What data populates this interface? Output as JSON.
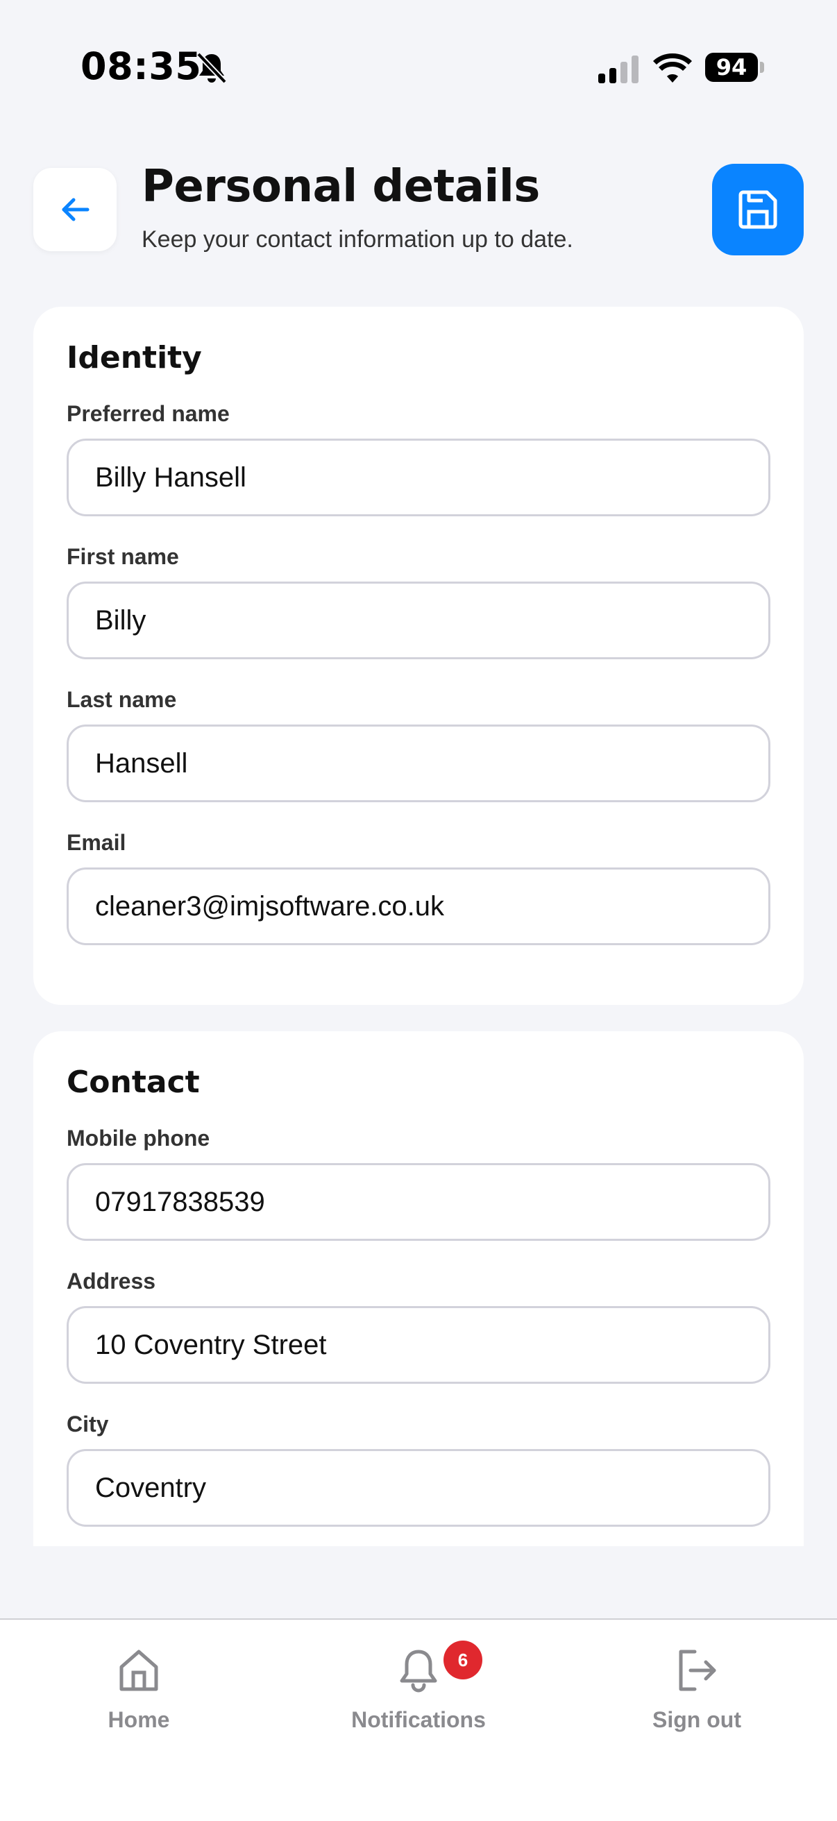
{
  "status_bar": {
    "time": "08:35",
    "battery": "94"
  },
  "header": {
    "title": "Personal details",
    "subtitle": "Keep your contact information up to date."
  },
  "identity": {
    "title": "Identity",
    "fields": [
      {
        "label": "Preferred name",
        "value": "Billy Hansell"
      },
      {
        "label": "First name",
        "value": "Billy"
      },
      {
        "label": "Last name",
        "value": "Hansell"
      },
      {
        "label": "Email",
        "value": "cleaner3@imjsoftware.co.uk"
      }
    ]
  },
  "contact": {
    "title": "Contact",
    "fields": [
      {
        "label": "Mobile phone",
        "value": "07917838539"
      },
      {
        "label": "Address",
        "value": "10 Coventry Street"
      },
      {
        "label": "City",
        "value": "Coventry"
      }
    ]
  },
  "nav": {
    "items": [
      {
        "label": "Home",
        "icon": "home-icon"
      },
      {
        "label": "Notifications",
        "icon": "bell-icon",
        "badge": "6"
      },
      {
        "label": "Sign out",
        "icon": "sign-out-icon"
      }
    ]
  },
  "colors": {
    "accent": "#0a84ff",
    "badge": "#e0282e",
    "background": "#f4f5f9"
  }
}
